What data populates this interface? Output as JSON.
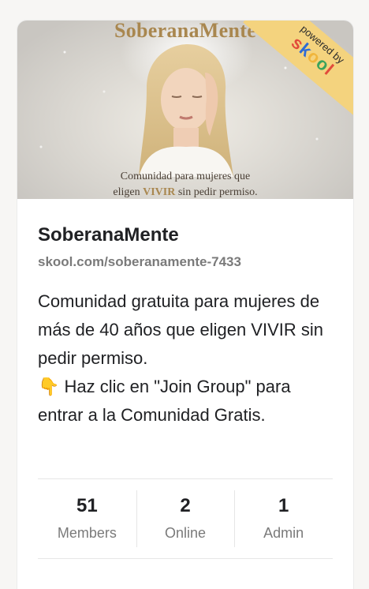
{
  "banner": {
    "title": "SoberanaMente",
    "caption_line1": "Comunidad para mujeres que",
    "caption_prefix": "eligen ",
    "caption_highlight": "VIVIR",
    "caption_suffix": " sin pedir permiso.",
    "ribbon_top": "powered by",
    "ribbon_brand": [
      "s",
      "k",
      "o",
      "o",
      "l"
    ]
  },
  "group": {
    "name": "SoberanaMente",
    "url": "skool.com/soberanamente-7433",
    "description_line1": "Comunidad gratuita para mujeres de más de 40 años que eligen VIVIR sin pedir permiso.",
    "description_line2": "👇 Haz clic en \"Join Group\" para entrar a la Comunidad Gratis."
  },
  "stats": [
    {
      "value": "51",
      "label": "Members"
    },
    {
      "value": "2",
      "label": "Online"
    },
    {
      "value": "1",
      "label": "Admin"
    }
  ],
  "colors": {
    "accent_gold": "#a9874f",
    "ribbon": "#f4d37e",
    "text": "#202124",
    "muted": "#7a7a7a"
  }
}
